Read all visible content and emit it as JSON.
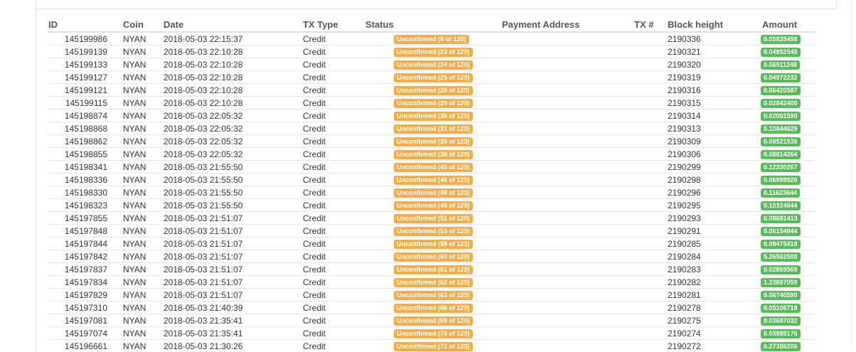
{
  "colors": {
    "status_badge": "#f0ad4e",
    "amount_badge": "#5cb85c"
  },
  "table": {
    "headers": {
      "id": "ID",
      "coin": "Coin",
      "date": "Date",
      "tx_type": "TX Type",
      "status": "Status",
      "payment_address": "Payment Address",
      "tx_num": "TX #",
      "block_height": "Block height",
      "amount": "Amount"
    },
    "rows": [
      {
        "id": "145199986",
        "coin": "NYAN",
        "date": "2018-05-03 22:15:37",
        "type": "Credit",
        "status": "Unconfirmed (8 of 120)",
        "address": "",
        "tx": "",
        "block": "2190336",
        "amount": "0.05835498"
      },
      {
        "id": "145199139",
        "coin": "NYAN",
        "date": "2018-05-03 22:10:28",
        "type": "Credit",
        "status": "Unconfirmed (23 of 120)",
        "address": "",
        "tx": "",
        "block": "2190321",
        "amount": "0.04952545"
      },
      {
        "id": "145199133",
        "coin": "NYAN",
        "date": "2018-05-03 22:10:28",
        "type": "Credit",
        "status": "Unconfirmed (24 of 120)",
        "address": "",
        "tx": "",
        "block": "2190320",
        "amount": "0.06911248"
      },
      {
        "id": "145199127",
        "coin": "NYAN",
        "date": "2018-05-03 22:10:28",
        "type": "Credit",
        "status": "Unconfirmed (25 of 120)",
        "address": "",
        "tx": "",
        "block": "2190319",
        "amount": "0.04972232"
      },
      {
        "id": "145199121",
        "coin": "NYAN",
        "date": "2018-05-03 22:10:28",
        "type": "Credit",
        "status": "Unconfirmed (28 of 120)",
        "address": "",
        "tx": "",
        "block": "2190316",
        "amount": "0.06420587"
      },
      {
        "id": "145199115",
        "coin": "NYAN",
        "date": "2018-05-03 22:10:28",
        "type": "Credit",
        "status": "Unconfirmed (29 of 120)",
        "address": "",
        "tx": "",
        "block": "2190315",
        "amount": "0.02842400"
      },
      {
        "id": "145198874",
        "coin": "NYAN",
        "date": "2018-05-03 22:05:32",
        "type": "Credit",
        "status": "Unconfirmed (30 of 120)",
        "address": "",
        "tx": "",
        "block": "2190314",
        "amount": "0.02061590"
      },
      {
        "id": "145198868",
        "coin": "NYAN",
        "date": "2018-05-03 22:05:32",
        "type": "Credit",
        "status": "Unconfirmed (31 of 120)",
        "address": "",
        "tx": "",
        "block": "2190313",
        "amount": "0.10844629"
      },
      {
        "id": "145198862",
        "coin": "NYAN",
        "date": "2018-05-03 22:05:32",
        "type": "Credit",
        "status": "Unconfirmed (35 of 120)",
        "address": "",
        "tx": "",
        "block": "2190309",
        "amount": "0.09521536"
      },
      {
        "id": "145198855",
        "coin": "NYAN",
        "date": "2018-05-03 22:05:32",
        "type": "Credit",
        "status": "Unconfirmed (38 of 120)",
        "address": "",
        "tx": "",
        "block": "2190306",
        "amount": "0.08814264"
      },
      {
        "id": "145198341",
        "coin": "NYAN",
        "date": "2018-05-03 21:55:50",
        "type": "Credit",
        "status": "Unconfirmed (45 of 120)",
        "address": "",
        "tx": "",
        "block": "2190299",
        "amount": "0.12330267"
      },
      {
        "id": "145198336",
        "coin": "NYAN",
        "date": "2018-05-03 21:55:50",
        "type": "Credit",
        "status": "Unconfirmed (46 of 120)",
        "address": "",
        "tx": "",
        "block": "2190298",
        "amount": "0.06999926"
      },
      {
        "id": "145198330",
        "coin": "NYAN",
        "date": "2018-05-03 21:55:50",
        "type": "Credit",
        "status": "Unconfirmed (48 of 120)",
        "address": "",
        "tx": "",
        "block": "2190296",
        "amount": "0.11623644"
      },
      {
        "id": "145198323",
        "coin": "NYAN",
        "date": "2018-05-03 21:55:50",
        "type": "Credit",
        "status": "Unconfirmed (49 of 120)",
        "address": "",
        "tx": "",
        "block": "2190295",
        "amount": "0.10324644"
      },
      {
        "id": "145197855",
        "coin": "NYAN",
        "date": "2018-05-03 21:51:07",
        "type": "Credit",
        "status": "Unconfirmed (51 of 120)",
        "address": "",
        "tx": "",
        "block": "2190293",
        "amount": "0.08681413"
      },
      {
        "id": "145197848",
        "coin": "NYAN",
        "date": "2018-05-03 21:51:07",
        "type": "Credit",
        "status": "Unconfirmed (53 of 120)",
        "address": "",
        "tx": "",
        "block": "2190291",
        "amount": "0.06154844"
      },
      {
        "id": "145197844",
        "coin": "NYAN",
        "date": "2018-05-03 21:51:07",
        "type": "Credit",
        "status": "Unconfirmed (59 of 120)",
        "address": "",
        "tx": "",
        "block": "2190285",
        "amount": "0.09475418"
      },
      {
        "id": "145197842",
        "coin": "NYAN",
        "date": "2018-05-03 21:51:07",
        "type": "Credit",
        "status": "Unconfirmed (60 of 120)",
        "address": "",
        "tx": "",
        "block": "2190284",
        "amount": "5.26562500"
      },
      {
        "id": "145197837",
        "coin": "NYAN",
        "date": "2018-05-03 21:51:07",
        "type": "Credit",
        "status": "Unconfirmed (61 of 120)",
        "address": "",
        "tx": "",
        "block": "2190283",
        "amount": "0.02869568"
      },
      {
        "id": "145197834",
        "coin": "NYAN",
        "date": "2018-05-03 21:51:07",
        "type": "Credit",
        "status": "Unconfirmed (62 of 120)",
        "address": "",
        "tx": "",
        "block": "2190282",
        "amount": "1.23897059"
      },
      {
        "id": "145197829",
        "coin": "NYAN",
        "date": "2018-05-03 21:51:07",
        "type": "Credit",
        "status": "Unconfirmed (63 of 120)",
        "address": "",
        "tx": "",
        "block": "2190281",
        "amount": "0.06740590"
      },
      {
        "id": "145197310",
        "coin": "NYAN",
        "date": "2018-05-03 21:40:39",
        "type": "Credit",
        "status": "Unconfirmed (66 of 120)",
        "address": "",
        "tx": "",
        "block": "2190278",
        "amount": "0.05106718"
      },
      {
        "id": "145197081",
        "coin": "NYAN",
        "date": "2018-05-03 21:35:41",
        "type": "Credit",
        "status": "Unconfirmed (69 of 120)",
        "address": "",
        "tx": "",
        "block": "2190275",
        "amount": "0.03687032"
      },
      {
        "id": "145197074",
        "coin": "NYAN",
        "date": "2018-05-03 21:35:41",
        "type": "Credit",
        "status": "Unconfirmed (70 of 120)",
        "address": "",
        "tx": "",
        "block": "2190274",
        "amount": "0.03989176"
      },
      {
        "id": "145196661",
        "coin": "NYAN",
        "date": "2018-05-03 21:30:26",
        "type": "Credit",
        "status": "Unconfirmed (72 of 120)",
        "address": "",
        "tx": "",
        "block": "2190272",
        "amount": "0.27386206"
      }
    ]
  }
}
